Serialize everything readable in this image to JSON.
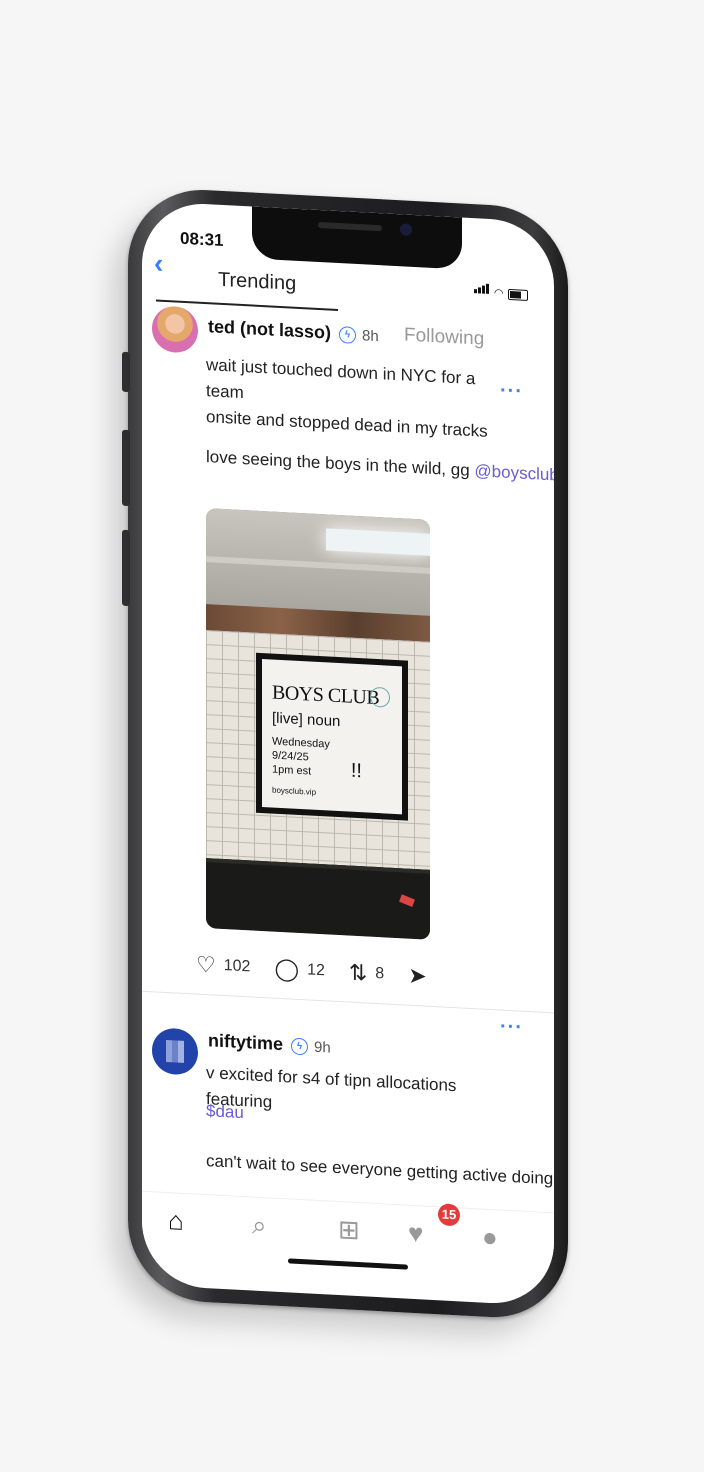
{
  "status": {
    "time": "08:31"
  },
  "nav": {
    "back_icon": "chevron-left-icon",
    "tabs": [
      {
        "label": "Trending",
        "active": true
      },
      {
        "label": "Following",
        "active": false
      }
    ]
  },
  "posts": [
    {
      "username": "ted (not lasso)",
      "time": "8h",
      "lines": [
        "wait just touched down in NYC for a team",
        "onsite and stopped dead in my tracks"
      ],
      "line2_text": "love seeing the boys in the wild, gg",
      "mention": "@boysclub",
      "image": {
        "poster_title": "BOYS CLUB",
        "poster_subtitle": "[live] noun",
        "poster_lines": [
          "Wednesday",
          "9/24/25",
          "1pm est",
          "boysclub.vip"
        ],
        "poster_mark": "!!"
      },
      "actions": {
        "likes": "102",
        "replies": "12",
        "recasts": "8"
      }
    },
    {
      "username": "niftytime",
      "time": "9h",
      "lines": [
        "v excited for s4 of tipn allocations featuring"
      ],
      "mention": "$dau",
      "line3_text": "can't wait to see everyone getting active doing"
    }
  ],
  "tabbar": {
    "notifications_count": "15",
    "icons": [
      "home-icon",
      "search-icon",
      "add-icon",
      "heart-icon",
      "profile-icon"
    ]
  }
}
